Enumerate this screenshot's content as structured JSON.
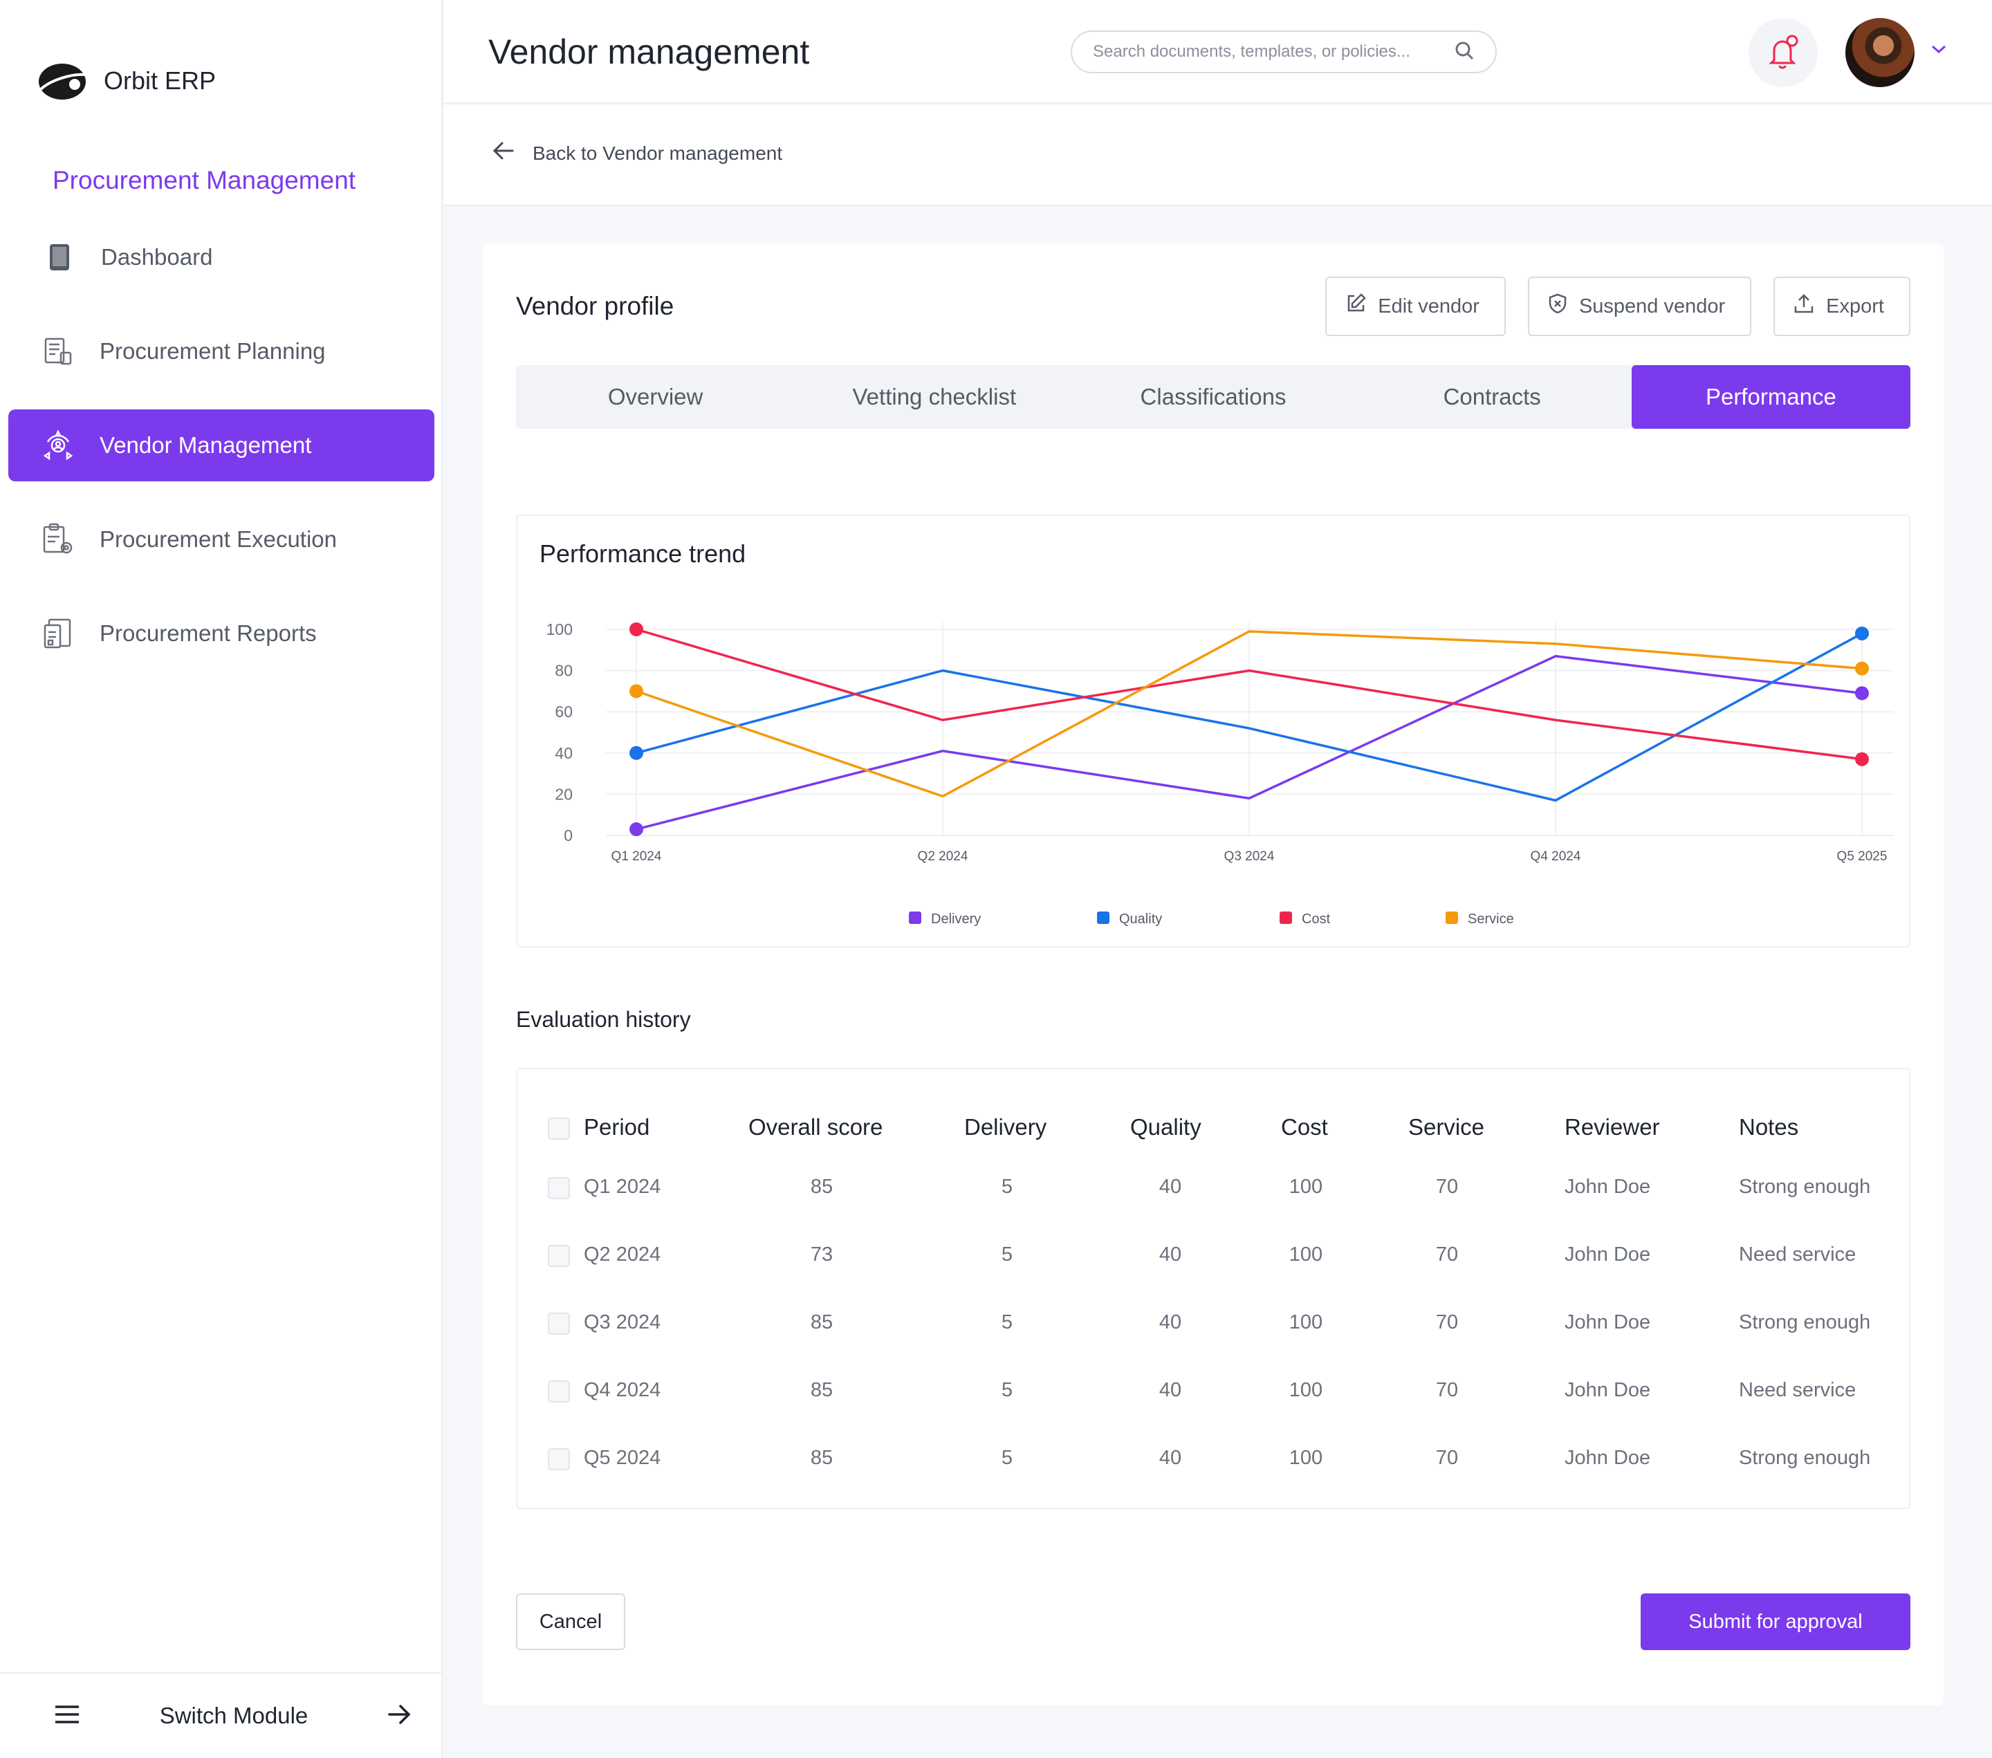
{
  "sidebar": {
    "brand": "Orbit ERP",
    "module_title": "Procurement Management",
    "items": [
      {
        "label": "Dashboard",
        "icon": "tablet-icon"
      },
      {
        "label": "Procurement Planning",
        "icon": "planning-icon"
      },
      {
        "label": "Vendor Management",
        "icon": "vendor-icon",
        "active": true
      },
      {
        "label": "Procurement Execution",
        "icon": "execution-icon"
      },
      {
        "label": "Procurement Reports",
        "icon": "reports-icon"
      }
    ],
    "footer_label": "Switch Module"
  },
  "header": {
    "title": "Vendor management",
    "search_placeholder": "Search documents, templates, or policies..."
  },
  "subheader": {
    "back_label": "Back to Vendor management"
  },
  "card": {
    "title": "Vendor profile",
    "actions": {
      "edit": "Edit vendor",
      "suspend": "Suspend vendor",
      "export": "Export"
    },
    "tabs": [
      "Overview",
      "Vetting checklist",
      "Classifications",
      "Contracts",
      "Performance"
    ],
    "active_tab": "Performance"
  },
  "chart_data": {
    "type": "line",
    "title": "Performance trend",
    "categories": [
      "Q1 2024",
      "Q2 2024",
      "Q3 2024",
      "Q4 2024",
      "Q5 2025"
    ],
    "ylim": [
      0,
      100
    ],
    "yticks": [
      0,
      20,
      40,
      60,
      80,
      100
    ],
    "grid": true,
    "legend_position": "bottom",
    "series": [
      {
        "name": "Delivery",
        "color": "#7c3aed",
        "values": [
          3,
          41,
          18,
          87,
          69
        ]
      },
      {
        "name": "Quality",
        "color": "#1a73e8",
        "values": [
          40,
          80,
          52,
          17,
          98
        ]
      },
      {
        "name": "Cost",
        "color": "#f0254f",
        "values": [
          100,
          56,
          80,
          56,
          37
        ]
      },
      {
        "name": "Service",
        "color": "#f59a0b",
        "values": [
          70,
          19,
          99,
          93,
          81
        ]
      }
    ]
  },
  "evaluation": {
    "title": "Evaluation history",
    "columns": [
      "Period",
      "Overall score",
      "Delivery",
      "Quality",
      "Cost",
      "Service",
      "Reviewer",
      "Notes"
    ],
    "rows": [
      [
        "Q1 2024",
        "85",
        "5",
        "40",
        "100",
        "70",
        "John Doe",
        "Strong enough"
      ],
      [
        "Q2 2024",
        "73",
        "5",
        "40",
        "100",
        "70",
        "John Doe",
        "Need service"
      ],
      [
        "Q3 2024",
        "85",
        "5",
        "40",
        "100",
        "70",
        "John Doe",
        "Strong enough"
      ],
      [
        "Q4 2024",
        "85",
        "5",
        "40",
        "100",
        "70",
        "John Doe",
        "Need service"
      ],
      [
        "Q5 2024",
        "85",
        "5",
        "40",
        "100",
        "70",
        "John Doe",
        "Strong enough"
      ]
    ]
  },
  "footer_buttons": {
    "cancel": "Cancel",
    "submit": "Submit for approval"
  }
}
